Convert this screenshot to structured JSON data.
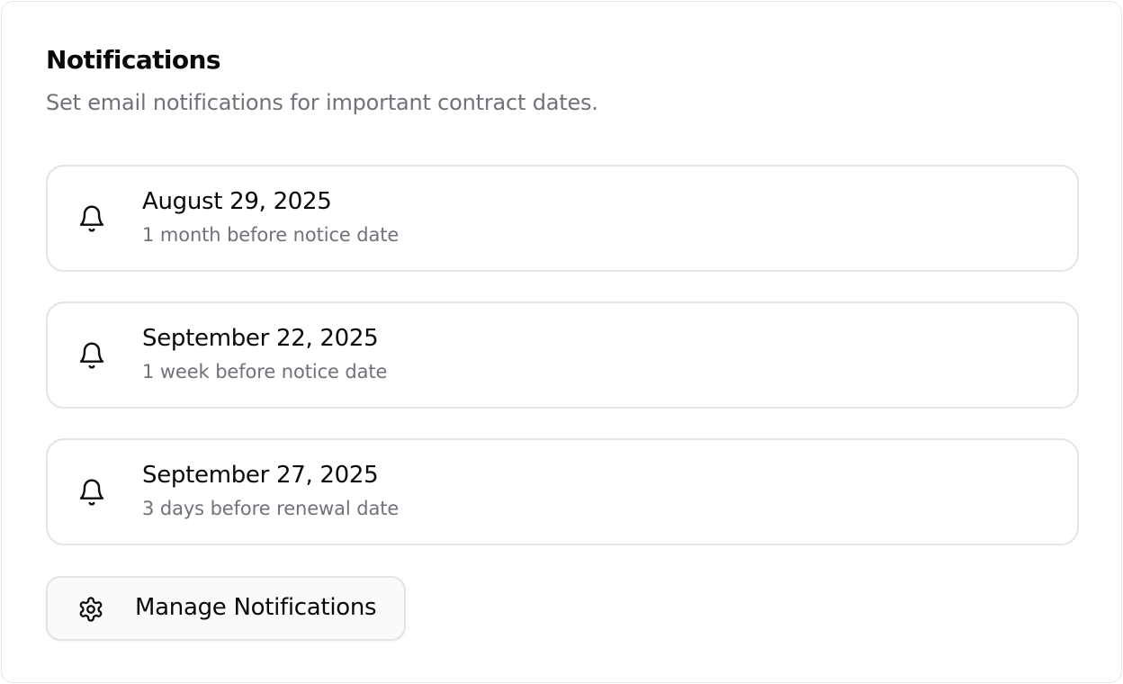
{
  "header": {
    "title": "Notifications",
    "subtitle": "Set email notifications for important contract dates."
  },
  "notifications": [
    {
      "date": "August 29, 2025",
      "description": "1 month before notice date",
      "icon": "bell-icon"
    },
    {
      "date": "September 22, 2025",
      "description": "1 week before notice date",
      "icon": "bell-icon"
    },
    {
      "date": "September 27, 2025",
      "description": "3 days before renewal date",
      "icon": "bell-icon"
    }
  ],
  "manage_button": {
    "label": "Manage Notifications",
    "icon": "gear-icon"
  },
  "colors": {
    "text_primary": "#09090b",
    "text_muted": "#71717a",
    "border": "#e4e4e7",
    "button_bg": "#f8fafc"
  }
}
